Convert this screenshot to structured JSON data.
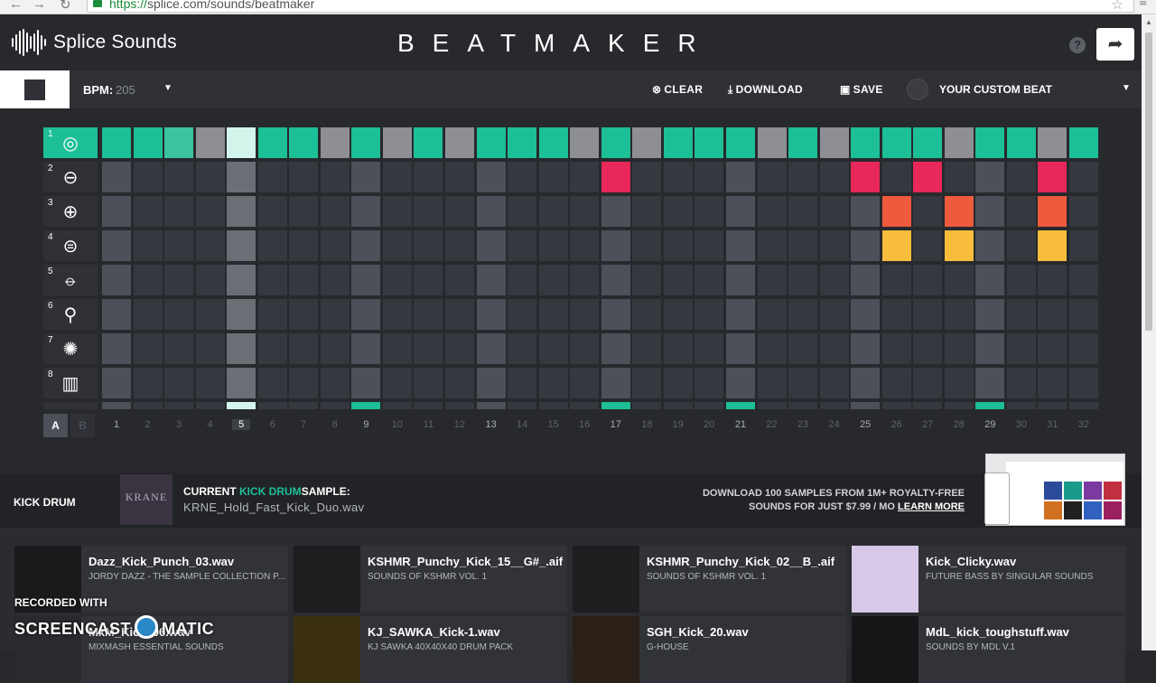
{
  "browser": {
    "url_scheme": "https://",
    "url_rest": "splice.com/sounds/beatmaker"
  },
  "header": {
    "logo_text": "Splice Sounds",
    "title": "BEATMAKER",
    "help_label": "?",
    "share_icon": "share-icon"
  },
  "toolbar": {
    "bpm_label": "BPM:",
    "bpm_value": "205",
    "clear_label": "CLEAR",
    "download_label": "DOWNLOAD",
    "save_label": "SAVE",
    "beat_name": "YOUR CUSTOM BEAT"
  },
  "colors": {
    "accent": "#1dbf96",
    "pink": "#e8285a",
    "orange": "#ee5a3c",
    "yellow": "#f7bd3b",
    "cell_off": "#363840",
    "cell_beat": "#4d5058",
    "playhead": "#d4f5ec"
  },
  "tracks": [
    {
      "num": "1",
      "icon": "kick-icon"
    },
    {
      "num": "2",
      "icon": "snare-icon"
    },
    {
      "num": "3",
      "icon": "hihat-icon"
    },
    {
      "num": "4",
      "icon": "cymbal-icon"
    },
    {
      "num": "5",
      "icon": "tom-icon"
    },
    {
      "num": "6",
      "icon": "mic-icon"
    },
    {
      "num": "7",
      "icon": "texture-icon"
    },
    {
      "num": "8",
      "icon": "keys-icon"
    }
  ],
  "sequencer": {
    "steps": 32,
    "current_step": 5,
    "active": {
      "1": [
        1,
        2,
        3,
        6,
        7,
        9,
        11,
        13,
        14,
        15,
        17,
        19,
        20,
        21,
        23,
        25,
        26,
        27,
        29,
        30,
        32
      ],
      "2": [
        17,
        25,
        27,
        31
      ],
      "3": [
        26,
        28,
        31
      ],
      "4": [
        26,
        28,
        31
      ]
    },
    "row9_active": [
      9,
      17,
      21,
      29
    ]
  },
  "patterns": [
    "A",
    "B"
  ],
  "step_labels": [
    "1",
    "2",
    "3",
    "4",
    "5",
    "6",
    "7",
    "8",
    "9",
    "10",
    "11",
    "12",
    "13",
    "14",
    "15",
    "16",
    "17",
    "18",
    "19",
    "20",
    "21",
    "22",
    "23",
    "24",
    "25",
    "26",
    "27",
    "28",
    "29",
    "30",
    "31",
    "32"
  ],
  "sample": {
    "instrument": "KICK DRUM",
    "art_text": "KRANE",
    "current_prefix": "CURRENT",
    "current_accent": "KICK DRUM",
    "current_suffix": "SAMPLE:",
    "file": "KRNE_Hold_Fast_Kick_Duo.wav",
    "promo_line1": "DOWNLOAD 100 SAMPLES FROM 1M+ ROYALTY-FREE",
    "promo_line2": "SOUNDS FOR JUST $7.99 / MO",
    "promo_link": "LEARN MORE"
  },
  "library": [
    {
      "name": "Dazz_Kick_Punch_03.wav",
      "pack": "JORDY DAZZ - THE SAMPLE COLLECTION P...",
      "art": "#1a1a1c"
    },
    {
      "name": "KSHMR_Punchy_Kick_15__G#_.aif",
      "pack": "SOUNDS OF KSHMR VOL. 1",
      "art": "#1e1e20"
    },
    {
      "name": "KSHMR_Punchy_Kick_02__B_.aif",
      "pack": "SOUNDS OF KSHMR VOL. 1",
      "art": "#1e1e20"
    },
    {
      "name": "Kick_Clicky.wav",
      "pack": "FUTURE BASS BY SINGULAR SOUNDS",
      "art": "#d8c8e8"
    },
    {
      "name": "MxM_Kick_06.wav",
      "pack": "MIXMASH ESSENTIAL SOUNDS",
      "art": "#2a2a2e"
    },
    {
      "name": "KJ_SAWKA_Kick-1.wav",
      "pack": "KJ SAWKA 40X40X40 DRUM PACK",
      "art": "#3a3010"
    },
    {
      "name": "SGH_Kick_20.wav",
      "pack": "G-HOUSE",
      "art": "#2a2018"
    },
    {
      "name": "MdL_kick_toughstuff.wav",
      "pack": "SOUNDS BY MDL V.1",
      "art": "#161618"
    }
  ],
  "watermark": {
    "top": "RECORDED WITH",
    "left": "SCREENCAST",
    "right": "MATIC"
  }
}
